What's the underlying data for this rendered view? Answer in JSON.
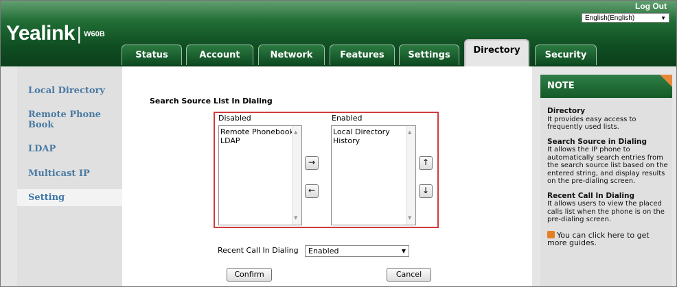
{
  "header": {
    "logo": "Yealink",
    "separator": "|",
    "model": "W60B",
    "logout": "Log Out",
    "language": "English(English)"
  },
  "tabs": [
    "Status",
    "Account",
    "Network",
    "Features",
    "Settings",
    "Directory",
    "Security"
  ],
  "active_tab": "Directory",
  "sidebar": {
    "items": [
      "Local Directory",
      "Remote Phone Book",
      "LDAP",
      "Multicast IP",
      "Setting"
    ],
    "active": "Setting"
  },
  "main": {
    "section_title": "Search Source List In Dialing",
    "disabled_label": "Disabled",
    "enabled_label": "Enabled",
    "disabled_items": [
      "Remote Phonebook",
      "LDAP"
    ],
    "enabled_items": [
      "Local Directory",
      "History"
    ],
    "move_right": "→",
    "move_left": "←",
    "move_up": "↑",
    "move_down": "↓",
    "recent_call_label": "Recent Call In Dialing",
    "recent_call_value": "Enabled",
    "confirm": "Confirm",
    "cancel": "Cancel"
  },
  "note": {
    "title": "NOTE",
    "sections": [
      {
        "title": "Directory",
        "text": "It provides easy access to frequently used lists."
      },
      {
        "title": "Search Source in Dialing",
        "text": "It allows the IP phone to automatically search entries from the search source list based on the entered string, and display results on the pre-dialing screen."
      },
      {
        "title": "Recent Call In Dialing",
        "text": "It allows users to view the placed calls list when the phone is on the pre-dialing screen."
      }
    ],
    "guide": "You can click here to get more guides."
  },
  "colors": {
    "header_green": "#1f6a33",
    "sidebar_link": "#4a7aa3",
    "highlight_border": "#d23a3a",
    "note_corner": "#e8893a"
  }
}
